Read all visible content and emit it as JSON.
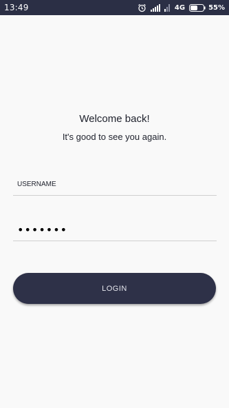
{
  "status_bar": {
    "time": "13:49",
    "network": "4G",
    "battery": "55%",
    "icons": [
      "alarm-icon",
      "signal-icon",
      "signal-weak-icon",
      "battery-icon"
    ]
  },
  "welcome": {
    "title": "Welcome back!",
    "subtitle": "It's good to see you again."
  },
  "form": {
    "username_placeholder": "USERNAME",
    "username_value": "",
    "password_value": "•••••••",
    "login_label": "LOGIN"
  },
  "colors": {
    "status_bar": "#2b2f45",
    "background": "#f9f9f9",
    "button": "#2e3148",
    "text": "#20232e"
  }
}
